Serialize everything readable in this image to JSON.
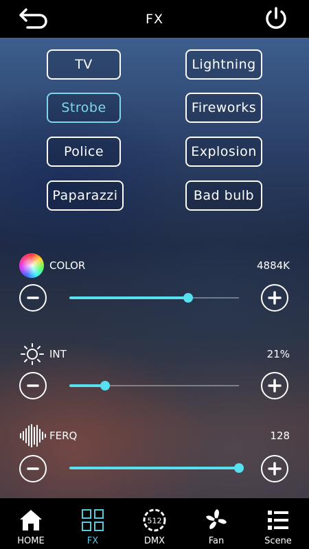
{
  "header": {
    "title": "FX"
  },
  "effects": [
    {
      "label": "TV",
      "active": false
    },
    {
      "label": "Lightning",
      "active": false
    },
    {
      "label": "Strobe",
      "active": true
    },
    {
      "label": "Fireworks",
      "active": false
    },
    {
      "label": "Police",
      "active": false
    },
    {
      "label": "Explosion",
      "active": false
    },
    {
      "label": "Paparazzi",
      "active": false
    },
    {
      "label": "Bad bulb",
      "active": false
    }
  ],
  "sliders": {
    "color": {
      "label": "COLOR",
      "value_text": "4884K",
      "level_fraction": 0.7,
      "icon": "color-wheel-icon"
    },
    "intensity": {
      "label": "INT",
      "value_text": "21%",
      "level_fraction": 0.21,
      "icon": "sun-icon"
    },
    "frequency": {
      "label": "FERQ",
      "value_text": "128",
      "level_fraction": 1.0,
      "icon": "waveform-icon"
    }
  },
  "nav": {
    "items": [
      {
        "label": "HOME",
        "icon": "home-icon",
        "active": false
      },
      {
        "label": "FX",
        "icon": "grid-icon",
        "active": true
      },
      {
        "label": "DMX",
        "icon": "dmx-icon",
        "icon_text": "512",
        "active": false
      },
      {
        "label": "Fan",
        "icon": "fan-icon",
        "active": false
      },
      {
        "label": "Scene",
        "icon": "list-icon",
        "active": false
      }
    ]
  },
  "colors": {
    "accent": "#57e0ef",
    "active_nav": "#5bc8dc",
    "active_button": "#7fd7ea"
  }
}
